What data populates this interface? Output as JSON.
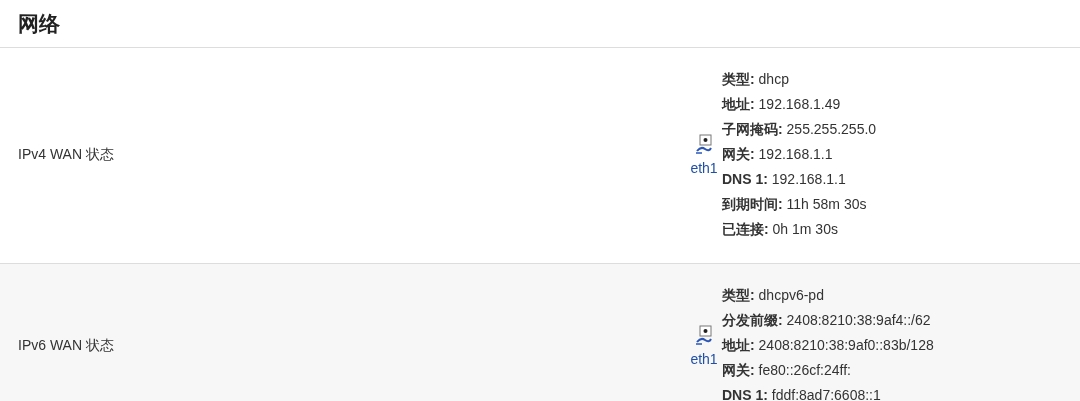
{
  "title": "网络",
  "rows": [
    {
      "label": "IPv4 WAN 状态",
      "interface": "eth1",
      "details": [
        {
          "key": "类型:",
          "value": "dhcp"
        },
        {
          "key": "地址:",
          "value": "192.168.1.49"
        },
        {
          "key": "子网掩码:",
          "value": "255.255.255.0"
        },
        {
          "key": "网关:",
          "value": "192.168.1.1"
        },
        {
          "key": "DNS 1:",
          "value": "192.168.1.1"
        },
        {
          "key": "到期时间:",
          "value": "11h 58m 30s"
        },
        {
          "key": "已连接:",
          "value": "0h 1m 30s"
        }
      ]
    },
    {
      "label": "IPv6 WAN 状态",
      "interface": "eth1",
      "details": [
        {
          "key": "类型:",
          "value": "dhcpv6-pd"
        },
        {
          "key": "分发前缀:",
          "value": "2408:8210:38:9af4::/62"
        },
        {
          "key": "地址:",
          "value": "2408:8210:38:9af0::83b/128"
        },
        {
          "key": "网关:",
          "value": "fe80::26cf:24ff:"
        },
        {
          "key": "DNS 1:",
          "value": "fddf:8ad7:6608::1"
        }
      ]
    }
  ]
}
